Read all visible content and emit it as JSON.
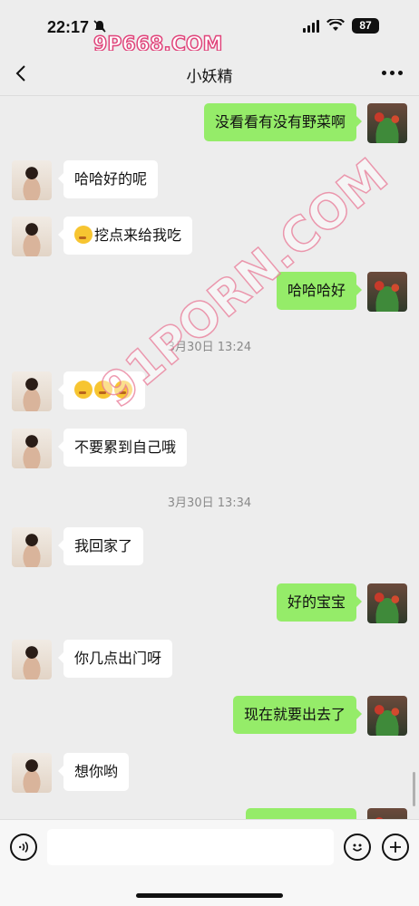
{
  "status_bar": {
    "time": "22:17",
    "battery": "87"
  },
  "watermark_top": "9P668.COM",
  "watermark_diagonal": "91PORN.COM",
  "nav": {
    "title": "小妖精"
  },
  "colors": {
    "bubble_sent": "#95ec69",
    "bubble_received": "#ffffff",
    "background": "#ededed"
  },
  "messages": [
    {
      "side": "right",
      "text": "没看看有没有野菜啊"
    },
    {
      "side": "left",
      "text": "哈哈好的呢"
    },
    {
      "side": "left",
      "text": "挖点来给我吃",
      "emoji": "thinking-emoji"
    },
    {
      "side": "right",
      "text": "哈哈哈好"
    },
    {
      "type": "time",
      "text": "3月30日 13:24"
    },
    {
      "side": "left",
      "text": "",
      "emoji": "kiss-emoji x3"
    },
    {
      "side": "left",
      "text": "不要累到自己哦"
    },
    {
      "type": "time",
      "text": "3月30日 13:34"
    },
    {
      "side": "left",
      "text": "我回家了"
    },
    {
      "side": "right",
      "text": "好的宝宝"
    },
    {
      "side": "left",
      "text": "你几点出门呀"
    },
    {
      "side": "right",
      "text": "现在就要出去了"
    },
    {
      "side": "left",
      "text": "想你哟"
    }
  ],
  "input_bar": {
    "placeholder": "",
    "icons": [
      "voice-icon",
      "emoji-icon",
      "add-icon"
    ]
  }
}
